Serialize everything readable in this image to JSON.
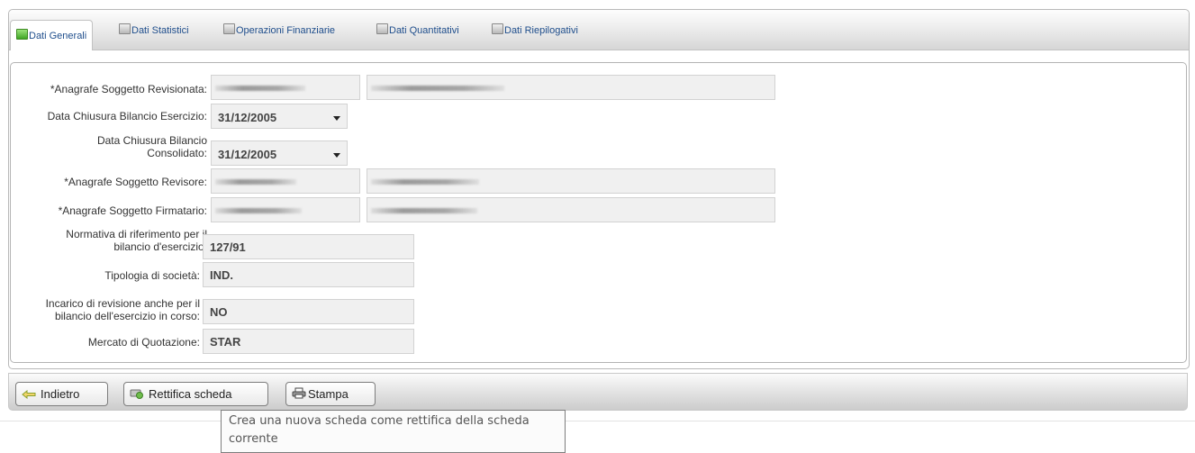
{
  "tabs": [
    {
      "label": "Dati Generali",
      "active": true
    },
    {
      "label": "Dati Statistici",
      "active": false
    },
    {
      "label": "Operazioni Finanziarie",
      "active": false
    },
    {
      "label": "Dati Quantitativi",
      "active": false
    },
    {
      "label": "Dati Riepilogativi",
      "active": false
    }
  ],
  "form": {
    "revisionata_label": "*Anagrafe Soggetto Revisionata:",
    "chiusura_esercizio_label": "Data Chiusura Bilancio Esercizio:",
    "chiusura_esercizio_value": "31/12/2005",
    "chiusura_consolidato_label_1": "Data Chiusura Bilancio",
    "chiusura_consolidato_label_2": "Consolidato:",
    "chiusura_consolidato_value": "31/12/2005",
    "revisore_label": "*Anagrafe Soggetto Revisore:",
    "firmatario_label": "*Anagrafe Soggetto Firmatario:",
    "normativa_label_1": "Normativa di riferimento per il",
    "normativa_label_2": "bilancio d'esercizio:",
    "normativa_value": "127/91",
    "tipologia_label": "Tipologia di società:",
    "tipologia_value": "IND.",
    "incarico_label_1": "Incarico di revisione anche per il",
    "incarico_label_2": "bilancio dell'esercizio in corso:",
    "incarico_value": "NO",
    "mercato_label": "Mercato di Quotazione:",
    "mercato_value": "STAR"
  },
  "toolbar": {
    "back_label": "Indietro",
    "rectify_label": "Rettifica scheda",
    "print_label": "Stampa"
  },
  "tooltip": {
    "text": "Crea una nuova scheda come rettifica della scheda corrente"
  },
  "colors": {
    "active_tab_icon": "#3fa524",
    "tab_text": "#1f4e8c"
  }
}
